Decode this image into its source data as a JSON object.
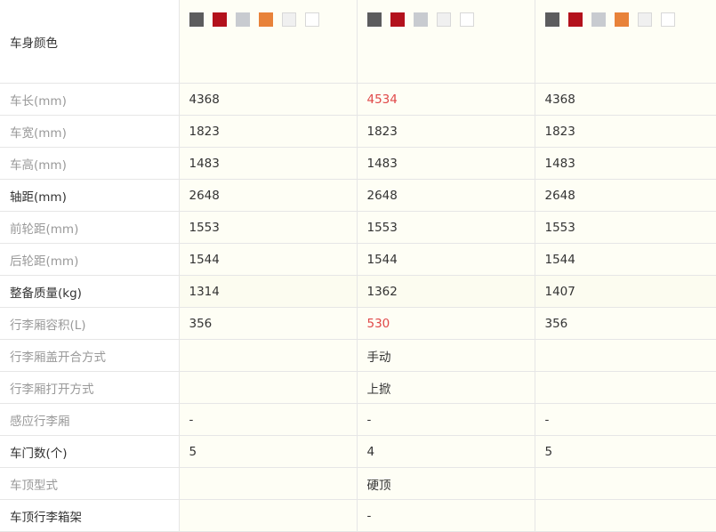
{
  "color_row": {
    "label": "车身颜色",
    "models": [
      {
        "swatches": [
          "#5c5c5e",
          "#b3111c",
          "#c8cbd0",
          "#e8823a",
          "#f0f0f0",
          "#ffffff"
        ]
      },
      {
        "swatches": [
          "#5c5c5e",
          "#b3111c",
          "#c8cbd0",
          "#f0f0f0",
          "#ffffff"
        ]
      },
      {
        "swatches": [
          "#5c5c5e",
          "#b3111c",
          "#c8cbd0",
          "#e8823a",
          "#f0f0f0",
          "#ffffff"
        ]
      }
    ]
  },
  "rows": [
    {
      "label": "车长(mm)",
      "values": [
        "4368",
        "4534",
        "4368"
      ],
      "diff": [
        false,
        true,
        false
      ]
    },
    {
      "label": "车宽(mm)",
      "values": [
        "1823",
        "1823",
        "1823"
      ]
    },
    {
      "label": "车高(mm)",
      "values": [
        "1483",
        "1483",
        "1483"
      ]
    },
    {
      "label": "轴距(mm)",
      "values": [
        "2648",
        "2648",
        "2648"
      ],
      "strong": true
    },
    {
      "label": "前轮距(mm)",
      "values": [
        "1553",
        "1553",
        "1553"
      ]
    },
    {
      "label": "后轮距(mm)",
      "values": [
        "1544",
        "1544",
        "1544"
      ]
    },
    {
      "label": "整备质量(kg)",
      "values": [
        "1314",
        "1362",
        "1407"
      ],
      "strong": true,
      "highlight": true
    },
    {
      "label": "行李厢容积(L)",
      "values": [
        "356",
        "530",
        "356"
      ],
      "diff": [
        false,
        true,
        false
      ]
    },
    {
      "label": "行李厢盖开合方式",
      "values": [
        "",
        "手动",
        ""
      ]
    },
    {
      "label": "行李厢打开方式",
      "values": [
        "",
        "上掀",
        ""
      ]
    },
    {
      "label": "感应行李厢",
      "values": [
        "-",
        "-",
        "-"
      ]
    },
    {
      "label": "车门数(个)",
      "values": [
        "5",
        "4",
        "5"
      ],
      "strong": true
    },
    {
      "label": "车顶型式",
      "values": [
        "",
        "硬顶",
        ""
      ]
    },
    {
      "label": "车顶行李箱架",
      "values": [
        "",
        "-",
        ""
      ],
      "strong": true
    }
  ]
}
